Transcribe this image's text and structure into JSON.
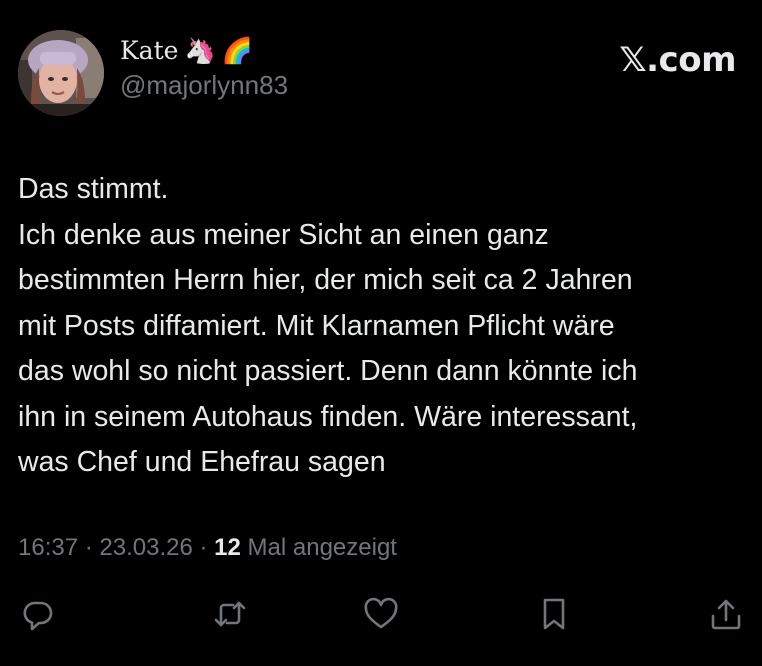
{
  "post": {
    "author": {
      "display_name": "Kate",
      "name_emojis": [
        "🦄",
        "🌈"
      ],
      "handle": "@majorlynn83"
    },
    "brand": "𝕏.com",
    "text_lines": [
      "Das stimmt.",
      "Ich denke aus meiner Sicht an einen ganz",
      "bestimmten Herrn hier, der mich seit ca 2 Jahren",
      "mit Posts diffamiert. Mit Klarnamen Pflicht wäre",
      "das wohl so nicht passiert. Denn dann könnte ich",
      "ihn in seinem Autohaus finden. Wäre interessant,",
      "was Chef und Ehefrau sagen"
    ],
    "time": "16:37",
    "separator": "·",
    "date": "23.03.26",
    "views_count": "12",
    "views_label": "Mal angezeigt"
  },
  "actions": [
    {
      "name": "reply-icon"
    },
    {
      "name": "repost-icon"
    },
    {
      "name": "like-icon"
    },
    {
      "name": "bookmark-icon"
    },
    {
      "name": "share-icon"
    }
  ],
  "colors": {
    "background": "#000000",
    "primary_text": "#e7e9ea",
    "secondary_text": "#71767b"
  }
}
